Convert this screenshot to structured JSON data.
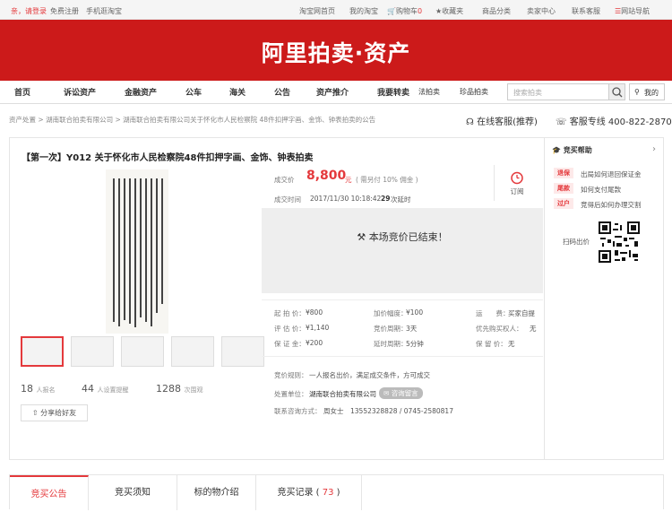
{
  "topbar": {
    "greet": "亲，请登录",
    "register": "免费注册",
    "mobile": "手机逛淘宝",
    "home": "淘宝网首页",
    "mytb": "我的淘宝",
    "cart": "购物车",
    "cart_count": "0",
    "fav": "收藏夹",
    "cat": "商品分类",
    "seller": "卖家中心",
    "service": "联系客服",
    "sitenav": "网站导航"
  },
  "banner": {
    "logo": "阿里拍卖·资产"
  },
  "nav": {
    "items": [
      "首页",
      "诉讼资产",
      "金融资产",
      "公车",
      "海关",
      "公告",
      "资产推介",
      "我要转卖",
      "法拍卖",
      "珍品拍卖"
    ],
    "search_placeholder": "搜索拍卖",
    "my": "我的"
  },
  "crumb": {
    "c1": "资产处置",
    "c2": "湖南联合拍卖有限公司",
    "c3": "湖南联合拍卖有限公司关于怀化市人民检察院 48件扣押字画、金饰、钟表拍卖的公告",
    "sep": ">"
  },
  "service": {
    "online": "在线客服(推荐)",
    "hotline": "客服专线 400-822-2870"
  },
  "item": {
    "title": "【第一次】Y012 关于怀化市人民检察院48件扣押字画、金饰、钟表拍卖",
    "price_label": "成交价",
    "price": "8,800",
    "price_unit": "元",
    "fee": "( 需另付 10% 佣金 )",
    "time_label": "成交时间",
    "time": "2017/11/30 10:18:42",
    "delay": "29",
    "delay_unit": "次延时",
    "remind": "订阅",
    "ended": "本场竞价已结束！"
  },
  "stats": {
    "signup": "18",
    "signup_label": "人报名",
    "remind": "44",
    "remind_label": "人设置提醒",
    "views": "1288",
    "views_label": "次围观",
    "share": "分享给好友"
  },
  "params": {
    "start_label": "起 拍 价：",
    "start": "¥800",
    "inc_label": "加价幅度：",
    "inc": "¥100",
    "ship_label": "运　　费：",
    "ship": "买家自提",
    "eval_label": "评 估 价：",
    "eval": "¥1,140",
    "cycle_label": "竞价周期：",
    "cycle": "3天",
    "prior_label": "优先购买权人：",
    "prior": "无",
    "deposit_label": "保 证 金：",
    "deposit": "¥200",
    "delay_label": "延时周期：",
    "delay": "5分钟",
    "reserve_label": "保 留 价：",
    "reserve": "无"
  },
  "rules": {
    "rule_label": "竞价规则：",
    "rule": "一人报名出价，满足成交条件，方可成交",
    "unit_label": "处置单位：",
    "unit": "湖南联合拍卖有限公司",
    "consult": "咨询留言",
    "contact_label": "联系咨询方式：",
    "contact": "周女士　13552328828 / 0745-2580817"
  },
  "help": {
    "title": "竞买帮助",
    "tags": [
      {
        "tag": "退保",
        "text": "出局如何退回保证金"
      },
      {
        "tag": "尾款",
        "text": "如何支付尾款"
      },
      {
        "tag": "过户",
        "text": "竞得后如何办理交割"
      }
    ],
    "scan": "扫码出价"
  },
  "tabs": {
    "t1": "竞买公告",
    "t2": "竞买须知",
    "t3": "标的物介绍",
    "t4": "竞买记录",
    "count": "73"
  },
  "colors": {
    "brand": "#cc1a1a",
    "accent": "#e4393c"
  }
}
